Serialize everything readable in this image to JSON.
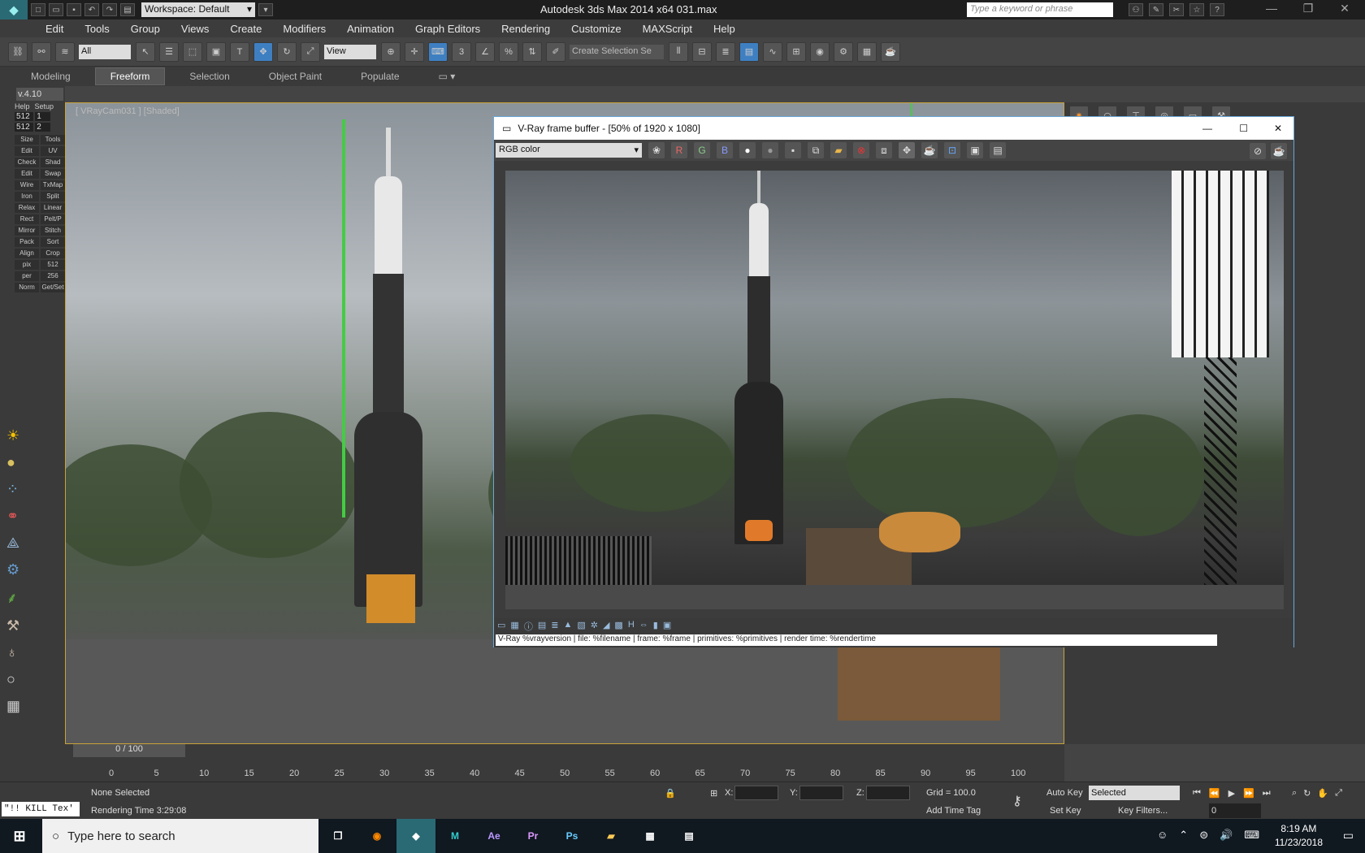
{
  "titlebar": {
    "workspace": "Workspace: Default",
    "app_title": "Autodesk 3ds Max  2014 x64      031.max",
    "search_placeholder": "Type a keyword or phrase",
    "help": "?"
  },
  "menu": [
    "Edit",
    "Tools",
    "Group",
    "Views",
    "Create",
    "Modifiers",
    "Animation",
    "Graph Editors",
    "Rendering",
    "Customize",
    "MAXScript",
    "Help"
  ],
  "toolbar": {
    "selection_filter": "All",
    "reference_coord": "View",
    "selection_set": "Create Selection Se",
    "snap_3": "3",
    "snap_percent": "%"
  },
  "ribbon_tabs": [
    "Modeling",
    "Freeform",
    "Selection",
    "Object Paint",
    "Populate"
  ],
  "left_panel": {
    "version": "v.4.10",
    "help": "Help",
    "setup": "Setup",
    "size_a": "512",
    "size_b": "512",
    "spin_a": "1",
    "spin_b": "2",
    "labels": [
      "Size",
      "Tools",
      "Edit",
      "UV",
      "Check",
      "Shad",
      "Edit",
      "Swap",
      "Wire",
      "TxMap",
      "Iron",
      "Split",
      "Relax",
      "Linear",
      "Rect",
      "Pelt/P",
      "Mirror",
      "Stitch",
      "Pack",
      "Sort",
      "Align",
      "Crop",
      "pix",
      "512",
      "per",
      "256",
      "Norm",
      "Get/Set"
    ]
  },
  "viewport": {
    "label": "[ VRayCam031 ] [Shaded]"
  },
  "vfb": {
    "title": "V-Ray frame buffer - [50% of 1920 x 1080]",
    "channel": "RGB color",
    "r": "R",
    "g": "G",
    "b": "B",
    "status": "V-Ray %vrayversion | file: %filename | frame: %frame | primitives: %primitives | render time: %rendertime"
  },
  "timeline": {
    "slider": "0 / 100",
    "ticks": [
      "0",
      "5",
      "10",
      "15",
      "20",
      "25",
      "30",
      "35",
      "40",
      "45",
      "50",
      "55",
      "60",
      "65",
      "70",
      "75",
      "80",
      "85",
      "90",
      "95",
      "100"
    ]
  },
  "status": {
    "script_field": "\"!! KILL Tex'",
    "selection": "None Selected",
    "render_time": "Rendering Time  3:29:08",
    "x_label": "X:",
    "y_label": "Y:",
    "z_label": "Z:",
    "grid": "Grid = 100.0",
    "add_time_tag": "Add Time Tag",
    "auto_key": "Auto Key",
    "set_key": "Set Key",
    "key_mode": "Selected",
    "key_filters": "Key Filters...",
    "frame": "0"
  },
  "taskbar": {
    "search": "Type here to search",
    "time": "8:19 AM",
    "date": "11/23/2018"
  },
  "colors": {
    "accent": "#6aa7d8",
    "viewport_border": "#c8a23a",
    "taskbar": "#101820"
  }
}
